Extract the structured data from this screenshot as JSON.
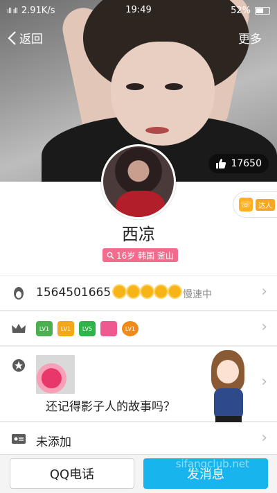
{
  "status_bar": {
    "signal": "ıll ıll",
    "network": "2.91K/s",
    "time": "19:49",
    "battery": "52%"
  },
  "nav": {
    "back_label": "返回",
    "more_label": "更多"
  },
  "cover": {
    "likes": "17650"
  },
  "profile": {
    "name": "西凉",
    "tag": "16岁 韩国 釜山",
    "badge": "达人"
  },
  "qq_row": {
    "number": "1564501665",
    "speed_label": "慢速中"
  },
  "gem_row": {
    "gems": [
      "LV1",
      "LV1",
      "LV5",
      "",
      "LV1"
    ]
  },
  "story_row": {
    "text": "还记得影子人的故事吗？"
  },
  "info_row": {
    "text": "未添加"
  },
  "bottom_bar": {
    "call_label": "QQ电话",
    "message_label": "发消息"
  },
  "watermark": "sifangclub.net",
  "colors": {
    "accent": "#18b4ed",
    "tag": "#f26d8d",
    "sun": "#f6b417"
  }
}
